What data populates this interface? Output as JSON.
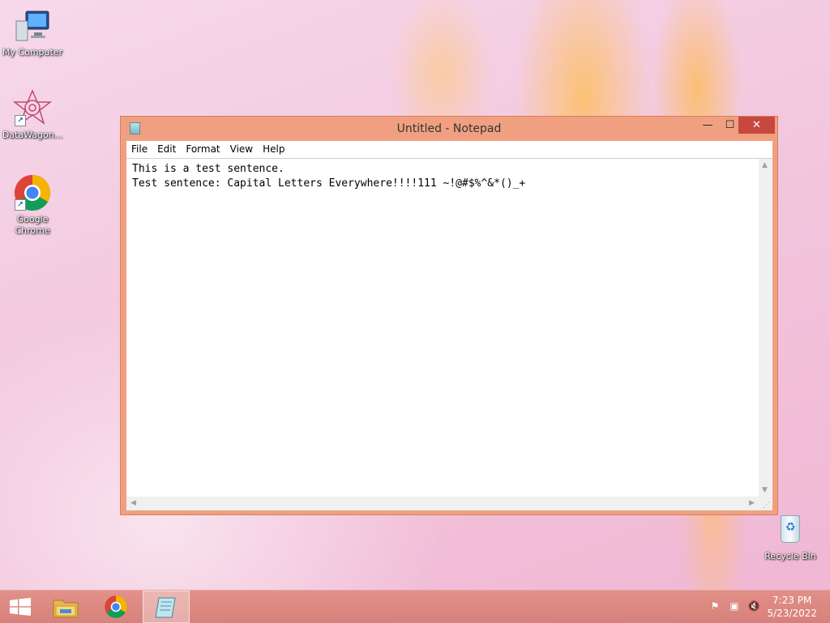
{
  "desktop": {
    "icons": [
      {
        "label": "My Computer",
        "icon": "computer-icon"
      },
      {
        "label": "DataWagon...",
        "icon": "datawagon-icon"
      },
      {
        "label": "Google Chrome",
        "icon": "chrome-icon"
      },
      {
        "label": "Recycle Bin",
        "icon": "recycle-bin-icon"
      }
    ]
  },
  "notepad": {
    "title": "Untitled - Notepad",
    "controls": {
      "minimize": "—",
      "maximize": "☐",
      "close": "✕"
    },
    "menu": [
      "File",
      "Edit",
      "Format",
      "View",
      "Help"
    ],
    "content": "This is a test sentence.\nTest sentence: Capital Letters Everywhere!!!!111 ~!@#$%^&*()_+"
  },
  "taskbar": {
    "items": [
      {
        "name": "start-button",
        "icon": "windows-logo-icon"
      },
      {
        "name": "file-explorer",
        "icon": "folder-icon"
      },
      {
        "name": "chrome",
        "icon": "chrome-icon"
      },
      {
        "name": "notepad",
        "icon": "notepad-icon",
        "active": true
      }
    ],
    "clock": {
      "time": "7:23 PM",
      "date": "5/23/2022"
    }
  },
  "colors": {
    "window_border": "#f0a080",
    "close_button": "#c7483f",
    "taskbar": "#d98a82"
  }
}
